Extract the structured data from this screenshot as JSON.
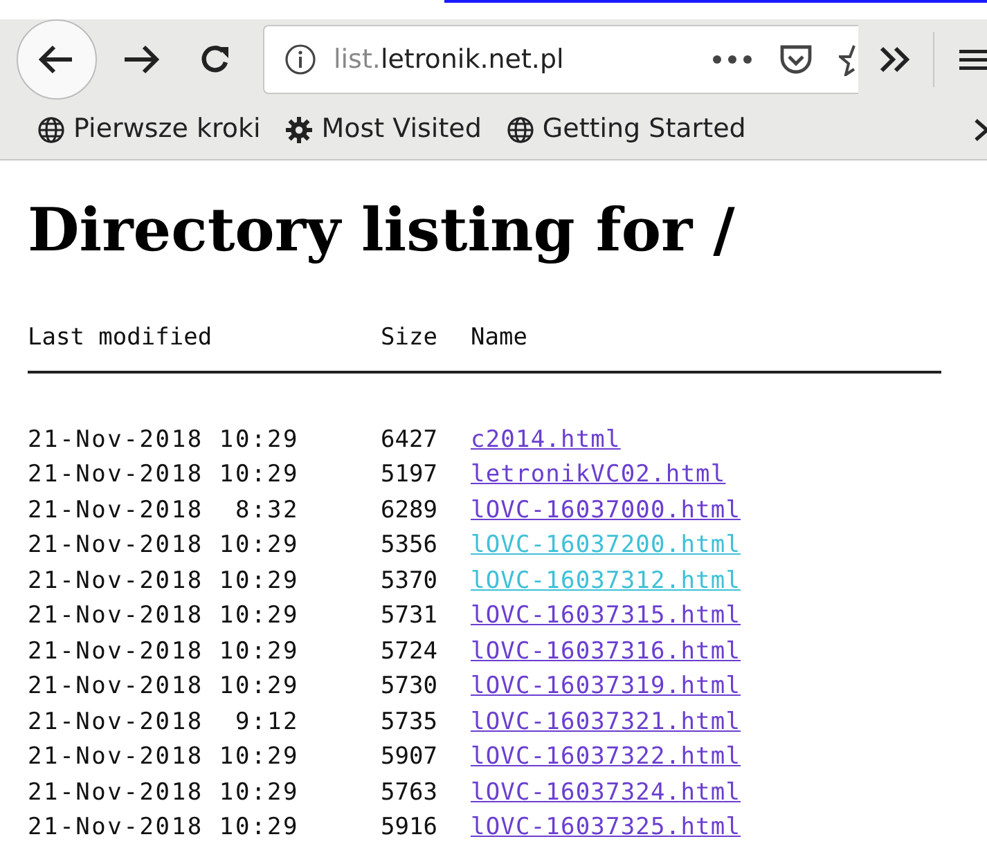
{
  "toolbar": {
    "url": {
      "subdomain": "list.",
      "domain": "letronik.net.pl"
    }
  },
  "bookmarks": [
    {
      "label": "Pierwsze kroki",
      "kind": "globe"
    },
    {
      "label": "Most Visited",
      "kind": "gear"
    },
    {
      "label": "Getting Started",
      "kind": "globe"
    }
  ],
  "heading": "Directory listing for /",
  "table": {
    "columns": [
      "Last modified",
      "Size",
      "Name"
    ],
    "rows": [
      {
        "modified": "21-Nov-2018 10:29",
        "size": "6427",
        "name": "c2014.html",
        "visited": true
      },
      {
        "modified": "21-Nov-2018 10:29",
        "size": "5197",
        "name": "letronikVC02.html",
        "visited": true
      },
      {
        "modified": "21-Nov-2018  8:32",
        "size": "6289",
        "name": "lOVC-16037000.html",
        "visited": true
      },
      {
        "modified": "21-Nov-2018 10:29",
        "size": "5356",
        "name": "lOVC-16037200.html",
        "visited": false
      },
      {
        "modified": "21-Nov-2018 10:29",
        "size": "5370",
        "name": "lOVC-16037312.html",
        "visited": false
      },
      {
        "modified": "21-Nov-2018 10:29",
        "size": "5731",
        "name": "lOVC-16037315.html",
        "visited": true
      },
      {
        "modified": "21-Nov-2018 10:29",
        "size": "5724",
        "name": "lOVC-16037316.html",
        "visited": true
      },
      {
        "modified": "21-Nov-2018 10:29",
        "size": "5730",
        "name": "lOVC-16037319.html",
        "visited": true
      },
      {
        "modified": "21-Nov-2018  9:12",
        "size": "5735",
        "name": "lOVC-16037321.html",
        "visited": true
      },
      {
        "modified": "21-Nov-2018 10:29",
        "size": "5907",
        "name": "lOVC-16037322.html",
        "visited": true
      },
      {
        "modified": "21-Nov-2018 10:29",
        "size": "5763",
        "name": "lOVC-16037324.html",
        "visited": true
      },
      {
        "modified": "21-Nov-2018 10:29",
        "size": "5916",
        "name": "lOVC-16037325.html",
        "visited": true
      }
    ]
  }
}
